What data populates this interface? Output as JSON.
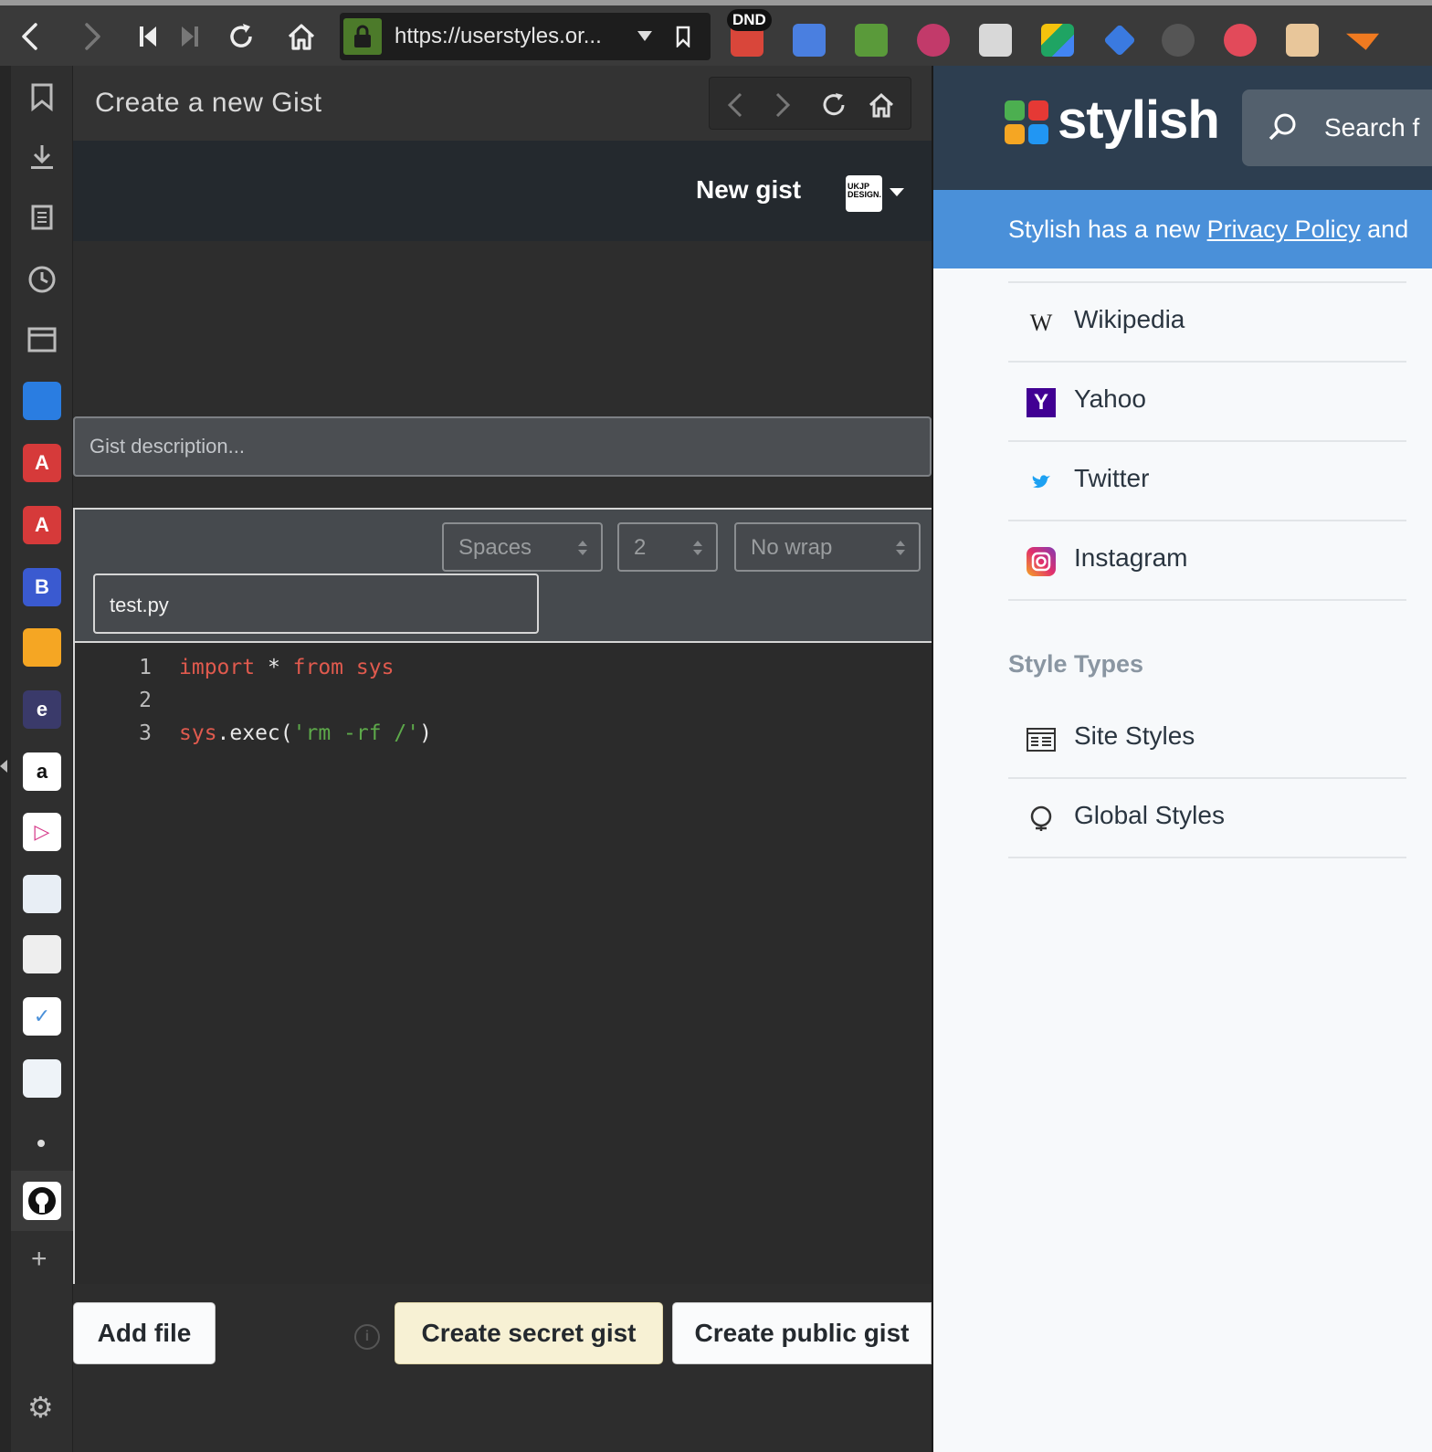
{
  "browser": {
    "url": "https://userstyles.or...",
    "dnd_badge": "DND"
  },
  "gist_panel": {
    "title": "Create a new Gist",
    "header": {
      "new_gist_label": "New gist",
      "avatar_text": "UKJP DESIGN."
    },
    "description_placeholder": "Gist description...",
    "editor_options": {
      "indent_mode": "Spaces",
      "indent_size": "2",
      "wrap_mode": "No wrap"
    },
    "filename": "test.py",
    "code_lines": [
      {
        "num": "1",
        "text": "import * from sys"
      },
      {
        "num": "2",
        "text": ""
      },
      {
        "num": "3",
        "text": "sys.exec('rm -rf /')"
      }
    ],
    "buttons": {
      "add_file": "Add file",
      "create_secret": "Create secret gist",
      "create_public": "Create public gist"
    }
  },
  "stylish": {
    "brand": "stylish",
    "search_placeholder": "Search f",
    "banner": {
      "prefix": "Stylish has a new ",
      "link": "Privacy Policy",
      "suffix": " and"
    },
    "sites": [
      {
        "label": "Wikipedia",
        "icon": "wikipedia-icon"
      },
      {
        "label": "Yahoo",
        "icon": "yahoo-icon"
      },
      {
        "label": "Twitter",
        "icon": "twitter-icon"
      },
      {
        "label": "Instagram",
        "icon": "instagram-icon"
      }
    ],
    "style_types_heading": "Style Types",
    "style_types": [
      {
        "label": "Site Styles",
        "icon": "site-styles-icon"
      },
      {
        "label": "Global Styles",
        "icon": "global-styles-icon"
      }
    ]
  },
  "colors": {
    "toolbar": "#3a3a3a",
    "github_header": "#24292e",
    "stylish_header": "#2d3e50",
    "stylish_banner": "#4a90d9",
    "secret_button": "#f7f1d4",
    "keyword": "#e05a4e",
    "string": "#5da94a"
  }
}
